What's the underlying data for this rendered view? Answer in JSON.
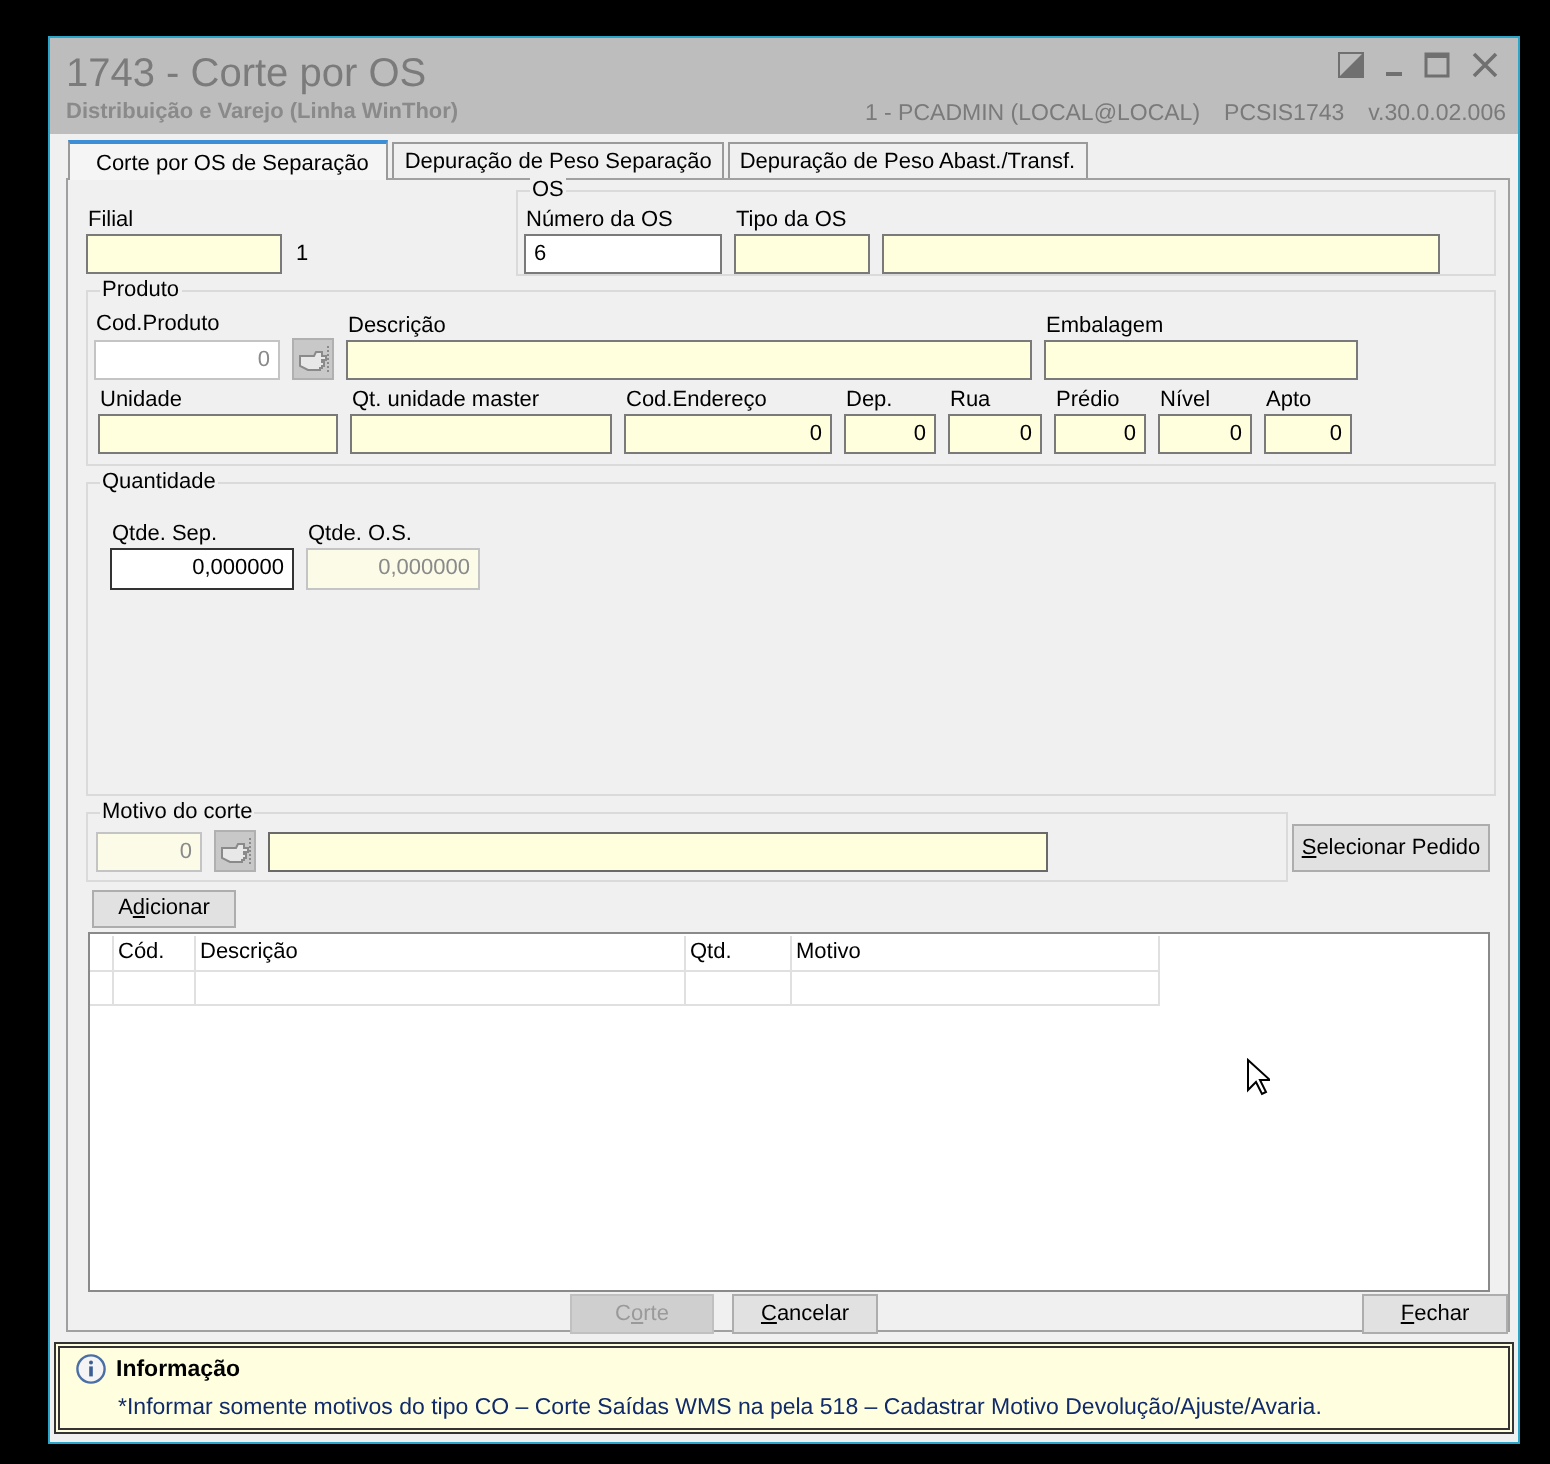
{
  "window": {
    "title": "1743 - Corte por OS",
    "subtitle": "Distribuição e Varejo (Linha WinThor)",
    "user": "1 - PCADMIN (LOCAL@LOCAL)",
    "program": "PCSIS1743",
    "version": "v.30.0.02.006"
  },
  "tabs": [
    {
      "label": "Corte por OS de Separação",
      "selected": true
    },
    {
      "label": "Depuração de Peso Separação",
      "selected": false
    },
    {
      "label": "Depuração de Peso Abast./Transf.",
      "selected": false
    }
  ],
  "filial": {
    "label": "Filial",
    "kind": "readonly",
    "disabled": false,
    "note": "1"
  },
  "os": {
    "legend": "OS",
    "fields": [
      {
        "label": "Número da OS",
        "kind": "editable",
        "disabled": false,
        "value": "6"
      },
      {
        "label": "Tipo da OS",
        "kind": "readonly",
        "disabled": false
      },
      {
        "kind": "readonly",
        "disabled": false
      }
    ]
  },
  "produto": {
    "legend": "Produto",
    "line_1": [
      {
        "label": "Cod.Produto",
        "kind": "editable",
        "disabled": true,
        "numeric": true,
        "value": "0",
        "lookup": true
      },
      {
        "label": "Descrição",
        "kind": "readonly",
        "disabled": false
      },
      {
        "label": "Embalagem",
        "kind": "readonly",
        "disabled": false
      }
    ],
    "line_2": [
      {
        "label": "Unidade",
        "kind": "readonly",
        "disabled": false
      },
      {
        "label": "Qt. unidade master",
        "kind": "readonly",
        "disabled": false
      },
      {
        "label": "Cod.Endereço",
        "kind": "readonly",
        "disabled": false,
        "numeric": true,
        "value": "0"
      },
      {
        "label": "Dep.",
        "kind": "readonly",
        "disabled": false,
        "numeric": true,
        "value": "0"
      },
      {
        "label": "Rua",
        "kind": "readonly",
        "disabled": false,
        "numeric": true,
        "value": "0"
      },
      {
        "label": "Prédio",
        "kind": "readonly",
        "disabled": false,
        "numeric": true,
        "value": "0"
      },
      {
        "label": "Nível",
        "kind": "readonly",
        "disabled": false,
        "numeric": true,
        "value": "0"
      },
      {
        "label": "Apto",
        "kind": "readonly",
        "disabled": false,
        "numeric": true,
        "value": "0"
      }
    ]
  },
  "quantidade": {
    "legend": "Quantidade",
    "fields": [
      {
        "label": "Qtde. Sep.",
        "kind": "editable",
        "disabled": false,
        "numeric": true,
        "value": "0,000000"
      },
      {
        "label": "Qtde. O.S.",
        "kind": "readonly",
        "disabled": true,
        "numeric": true,
        "value": "0,000000"
      }
    ]
  },
  "motivo": {
    "legend": "Motivo do corte",
    "fields": [
      {
        "kind": "readonly",
        "disabled": true,
        "numeric": true,
        "value": "0",
        "lookup": true
      },
      {
        "kind": "readonly",
        "disabled": false
      }
    ]
  },
  "select_button": {
    "label_parts": [
      {
        "text": "S",
        "underlined": true
      },
      {
        "text": "elecionar Pedido",
        "underlined": false
      }
    ],
    "disabled": false
  },
  "add_button": {
    "label_parts": [
      {
        "text": "A",
        "underlined": false
      },
      {
        "text": "d",
        "underlined": true
      },
      {
        "text": "icionar",
        "underlined": false
      }
    ],
    "disabled": false
  },
  "table": {
    "columns": [
      {
        "label": "Cód."
      },
      {
        "label": "Descrição"
      },
      {
        "label": "Qtd."
      },
      {
        "label": "Motivo"
      }
    ]
  },
  "buttons": [
    {
      "label_parts": [
        {
          "text": "C",
          "underlined": false
        },
        {
          "text": "o",
          "underlined": true
        },
        {
          "text": "rte",
          "underlined": false
        }
      ],
      "disabled": true
    },
    {
      "label_parts": [
        {
          "text": "C",
          "underlined": true
        },
        {
          "text": "ancelar",
          "underlined": false
        }
      ],
      "disabled": false
    },
    {
      "label_parts": [
        {
          "text": "F",
          "underlined": true
        },
        {
          "text": "echar",
          "underlined": false
        }
      ],
      "disabled": false
    }
  ],
  "info": {
    "title": "Informação",
    "message": "*Informar somente motivos do tipo CO – Corte Saídas WMS na pela 518 – Cadastrar Motivo Devolução/Ajuste/Avaria."
  }
}
